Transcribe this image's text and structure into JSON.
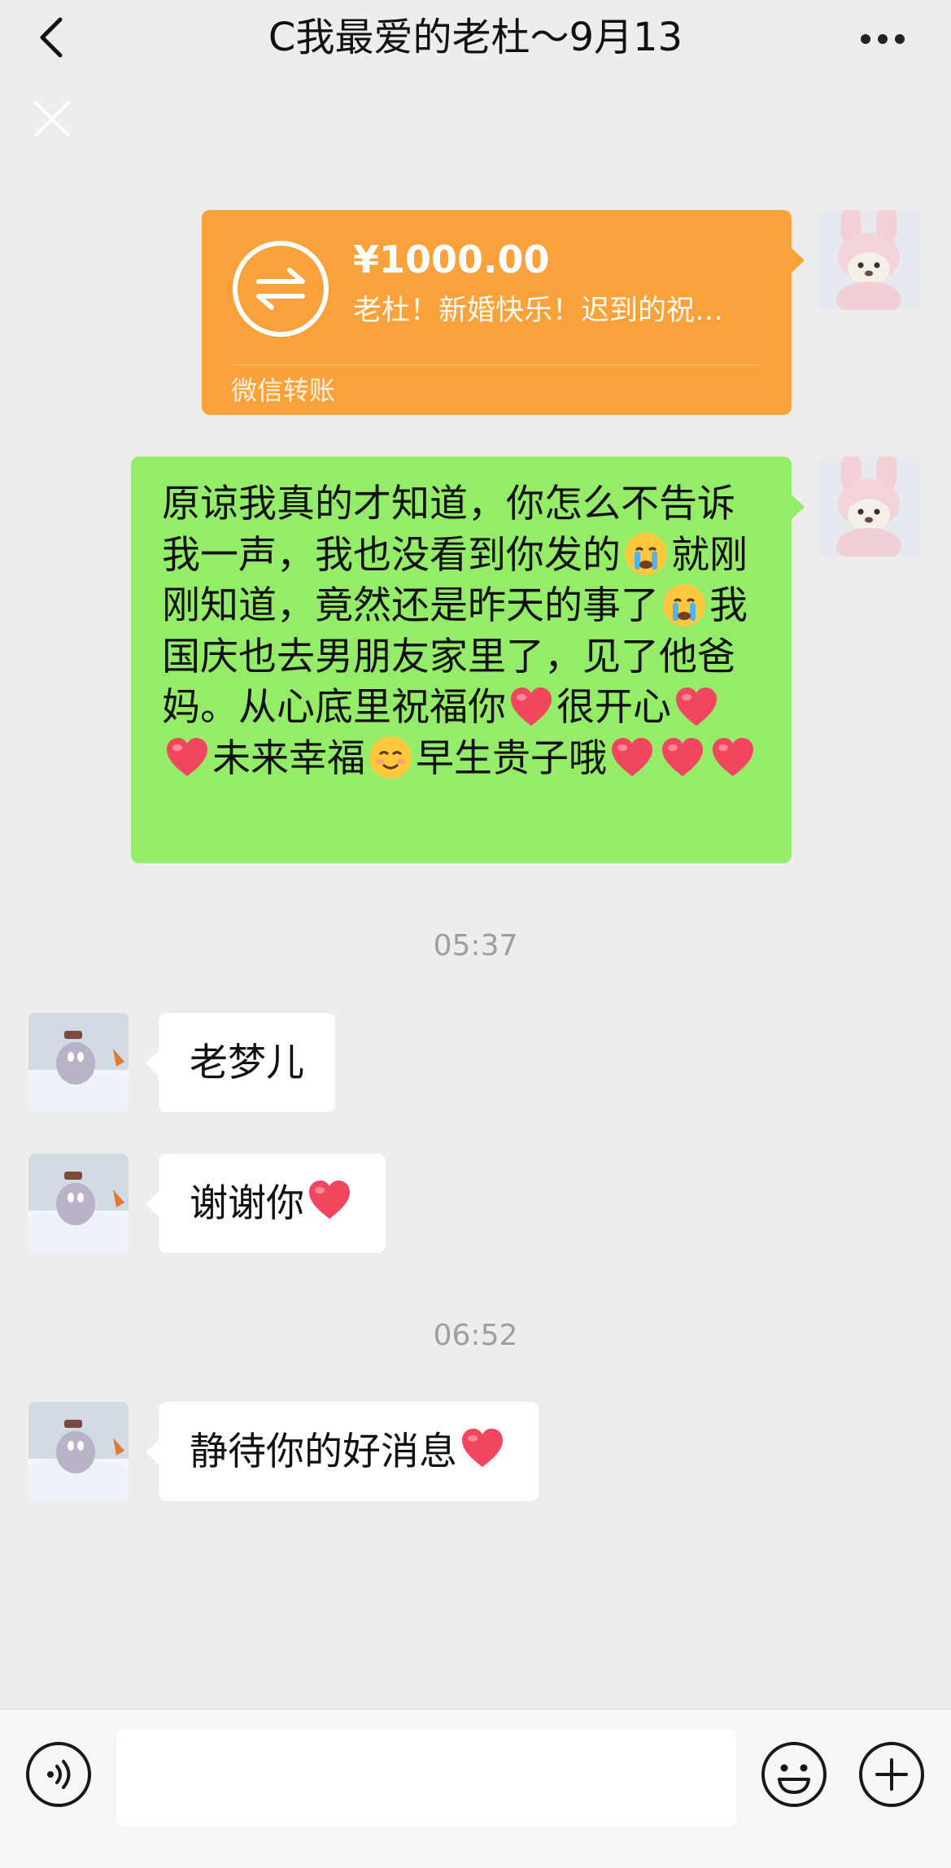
{
  "header": {
    "title": "C我最爱的老杜～9月13",
    "back_icon": "chevron-left-icon",
    "more_icon": "more-dots-icon"
  },
  "close_icon": "close-icon",
  "messages": [
    {
      "type": "transfer",
      "side": "right",
      "amount": "¥1000.00",
      "note": "老杜！新婚快乐！迟到的祝…",
      "footer": "微信转账",
      "color": "#f9a23c"
    },
    {
      "type": "text",
      "side": "right",
      "segments": [
        "原谅我真的才知道，你怎么不告诉我一声，我也没看到你发的",
        "就刚刚知道，竟然还是昨天的事了",
        "我国庆也去男朋友家里了，见了他爸妈。从心底里祝福你",
        "很开心",
        "未来幸福",
        "早生贵子哦"
      ],
      "color": "#95ec69"
    },
    {
      "type": "time",
      "text": "05:37"
    },
    {
      "type": "text",
      "side": "left",
      "text": "老梦儿"
    },
    {
      "type": "text",
      "side": "left",
      "text": "谢谢你"
    },
    {
      "type": "time",
      "text": "06:52"
    },
    {
      "type": "text",
      "side": "left",
      "text": "静待你的好消息"
    }
  ],
  "input_bar": {
    "voice_icon": "voice-icon",
    "input_value": "",
    "emoji_icon": "smiley-icon",
    "plus_icon": "plus-icon"
  }
}
